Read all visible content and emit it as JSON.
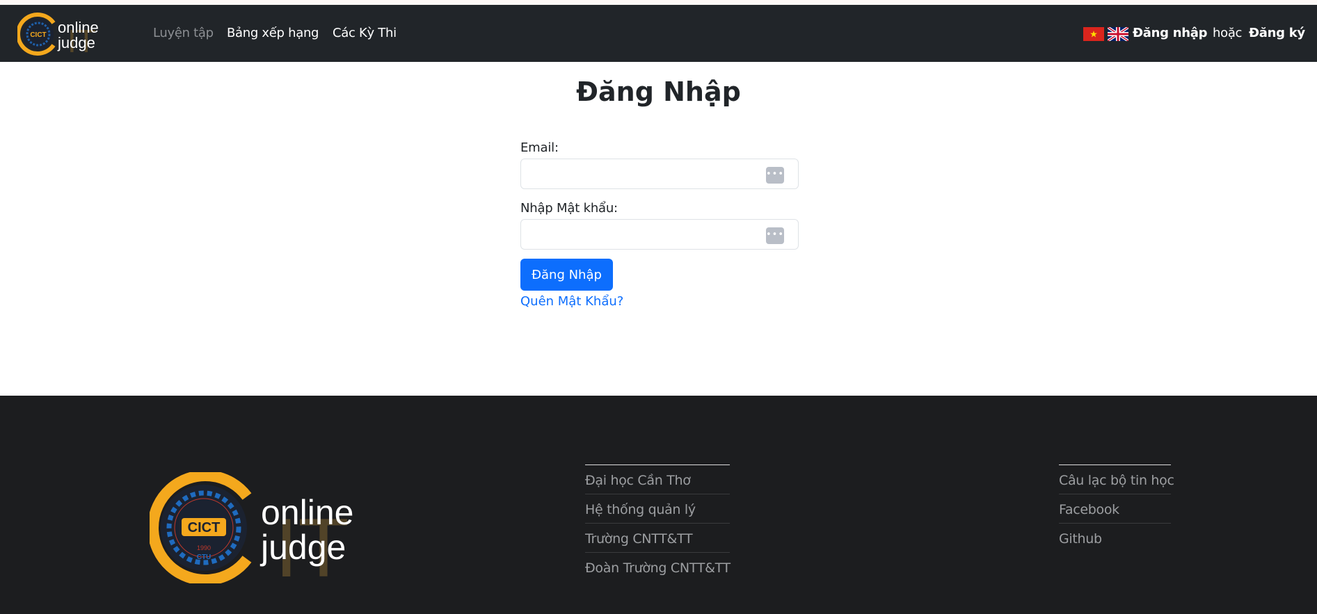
{
  "navbar": {
    "logo": {
      "badge": "CICT",
      "line1": "online",
      "line2": "judge",
      "watermark": "IT"
    },
    "links": [
      {
        "label": "Luyện tập",
        "active": false
      },
      {
        "label": "Bảng xếp hạng"
      },
      {
        "label": "Các Kỳ Thi"
      }
    ],
    "flags": [
      "vietnam-flag-icon",
      "uk-flag-icon"
    ],
    "login_label": "Đăng nhập",
    "or_label": "hoặc",
    "register_label": "Đăng ký"
  },
  "main": {
    "title": "Đăng Nhập",
    "email_label": "Email:",
    "email_value": "",
    "password_label": "Nhập Mật khẩu:",
    "password_value": "",
    "submit_label": "Đăng Nhập",
    "forgot_label": "Quên Mật Khẩu?",
    "accent": "#0d6efd"
  },
  "footer": {
    "logo": {
      "badge": "CICT",
      "year": "1990",
      "org": "CTU",
      "line1": "online",
      "line2": "judge",
      "watermark": "IT"
    },
    "col1": [
      "Đại học Cần Thơ",
      "Hệ thống quản lý",
      "Trường CNTT&TT",
      "Đoàn Trường CNTT&TT"
    ],
    "col2": [
      "Câu lạc bộ tin học",
      "Facebook",
      "Github"
    ]
  }
}
